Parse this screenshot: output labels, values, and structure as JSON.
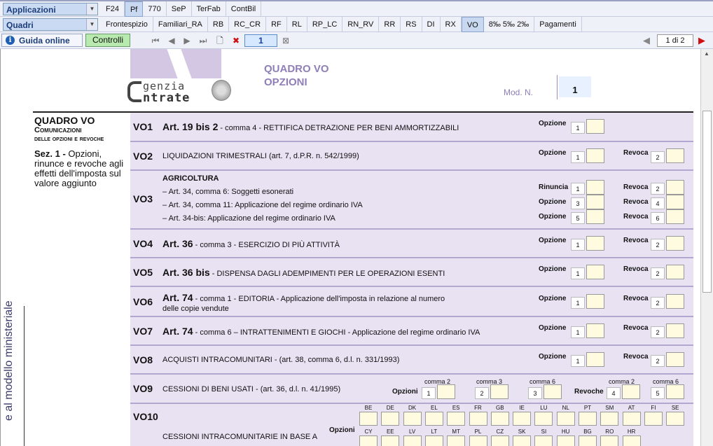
{
  "menu": {
    "applicazioni_label": "Applicazioni",
    "quadri_label": "Quadri",
    "apps": [
      "F24",
      "Pf",
      "770",
      "SeP",
      "TerFab",
      "ContBil"
    ],
    "apps_active": 1,
    "quadri": [
      "Frontespizio",
      "Familiari_RA",
      "RB",
      "RC_CR",
      "RF",
      "RL",
      "RP_LC",
      "RN_RV",
      "RR",
      "RS",
      "DI",
      "RX",
      "VO",
      "8‰ 5‰ 2‰",
      "Pagamenti"
    ],
    "quadri_active": 12
  },
  "toolbar": {
    "guida_label": "Guida online",
    "controlli_label": "Controlli",
    "current_page": "1",
    "page_count": "1 di 2"
  },
  "page": {
    "title_line1": "QUADRO VO",
    "title_line2": "OPZIONI",
    "agency_line1": "genzia",
    "agency_line2": "ntrate",
    "mod_label": "Mod. N.",
    "mod_value": "1",
    "side_title": "QUADRO VO",
    "side_sub1": "Comunicazioni",
    "side_sub2": "delle opzioni e revoche",
    "sez_bold": "Sez. 1 -",
    "sez_text": " Opzioni, rinunce e revoche agli effetti dell'imposta sul valore aggiunto",
    "vertical_text": "e al modello ministeriale"
  },
  "labels": {
    "opzione": "Opzione",
    "revoca": "Revoca",
    "rinuncia": "Rinuncia",
    "opzioni": "Opzioni",
    "revoche": "Revoche"
  },
  "rows": [
    {
      "code": "VO1",
      "bold": "Art. 19 bis 2",
      "text": " - comma 4 - RETTIFICA DETRAZIONE PER BENI AMMORTIZZABILI"
    },
    {
      "code": "VO2",
      "bold": "",
      "text": "LIQUIDAZIONI TRIMESTRALI  (art. 7, d.P.R. n. 542/1999)"
    },
    {
      "code": "VO3",
      "header": "AGRICOLTURA",
      "lines": [
        "– Art. 34, comma   6: Soggetti esonerati",
        "– Art. 34, comma 11: Applicazione del regime ordinario IVA",
        "– Art. 34-bis: Applicazione del regime ordinario IVA"
      ]
    },
    {
      "code": "VO4",
      "bold": "Art. 36",
      "text": " - comma 3 - ESERCIZIO DI PIÙ ATTIVITÀ"
    },
    {
      "code": "VO5",
      "bold": "Art. 36 bis",
      "text": " - DISPENSA DAGLI ADEMPIMENTI PER LE OPERAZIONI ESENTI"
    },
    {
      "code": "VO6",
      "bold": "Art. 74",
      "text": " - comma 1 - EDITORIA - Applicazione dell'imposta in relazione al numero",
      "text2": "delle copie vendute"
    },
    {
      "code": "VO7",
      "bold": "Art. 74",
      "text": " - comma   6 – INTRATTENIMENTI E GIOCHI - Applicazione del regime ordinario IVA"
    },
    {
      "code": "VO8",
      "bold": "",
      "text": "ACQUISTI INTRACOMUNITARI - (art. 38, comma 6, d.l. n. 331/1993)"
    },
    {
      "code": "VO9",
      "bold": "",
      "text": "CESSIONI DI BENI USATI - (art. 36, d.l. n. 41/1995)"
    },
    {
      "code": "VO10",
      "bold": "",
      "text": "CESSIONI INTRACOMUNITARIE IN BASE A"
    }
  ],
  "vo9": {
    "comma2": "comma 2",
    "comma3": "comma 3",
    "comma6": "comma 6",
    "rev_comma2": "comma 2",
    "rev_comma6": "comma 6"
  },
  "countries_row1": [
    "BE",
    "DE",
    "DK",
    "EL",
    "ES",
    "FR",
    "GB",
    "IE",
    "LU",
    "NL",
    "PT",
    "SM",
    "AT",
    "FI",
    "SE"
  ],
  "countries_row2": [
    "CY",
    "EE",
    "LV",
    "LT",
    "MT",
    "PL",
    "CZ",
    "SK",
    "SI",
    "HU",
    "BG",
    "RO",
    "HR"
  ],
  "nums": {
    "n1": "1",
    "n2": "2",
    "n3": "3",
    "n4": "4",
    "n5": "5",
    "n6": "6"
  }
}
